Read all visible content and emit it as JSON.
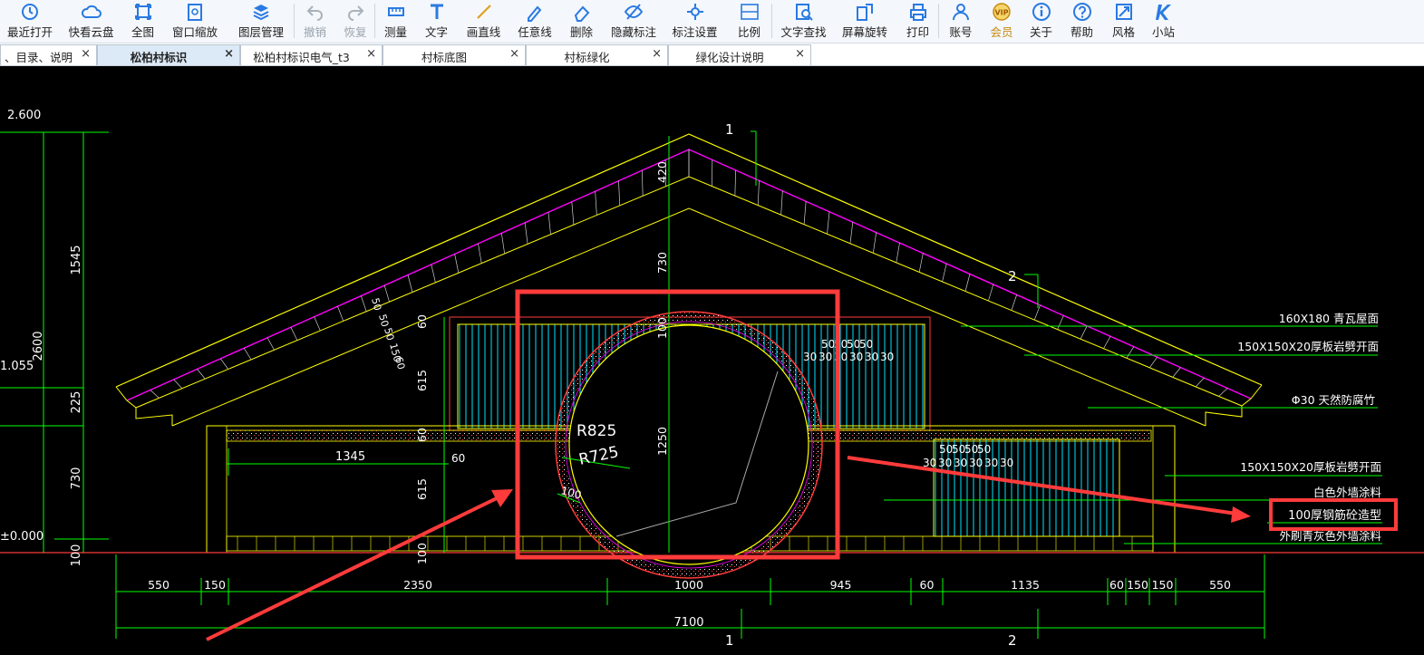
{
  "toolbar": {
    "buttons": [
      {
        "label": "最近打开",
        "icon": "recent-icon"
      },
      {
        "label": "快看云盘",
        "icon": "cloud-icon"
      },
      {
        "label": "全图",
        "icon": "fullview-icon"
      },
      {
        "label": "窗口缩放",
        "icon": "window-zoom-icon"
      },
      {
        "label": "图层管理",
        "icon": "layers-icon"
      },
      {
        "label": "撤销",
        "icon": "undo-icon"
      },
      {
        "label": "恢复",
        "icon": "redo-icon"
      },
      {
        "label": "测量",
        "icon": "measure-icon"
      },
      {
        "label": "文字",
        "icon": "text-icon"
      },
      {
        "label": "画直线",
        "icon": "line-icon"
      },
      {
        "label": "任意线",
        "icon": "freeline-icon"
      },
      {
        "label": "删除",
        "icon": "eraser-icon"
      },
      {
        "label": "隐藏标注",
        "icon": "eye-hide-icon"
      },
      {
        "label": "标注设置",
        "icon": "annotation-settings-icon"
      },
      {
        "label": "比例",
        "icon": "scale-icon"
      },
      {
        "label": "文字查找",
        "icon": "text-search-icon"
      },
      {
        "label": "屏幕旋转",
        "icon": "rotate-icon"
      },
      {
        "label": "打印",
        "icon": "print-icon"
      },
      {
        "label": "账号",
        "icon": "account-icon"
      },
      {
        "label": "会员",
        "icon": "vip-icon"
      },
      {
        "label": "关于",
        "icon": "info-icon"
      },
      {
        "label": "帮助",
        "icon": "help-icon"
      },
      {
        "label": "风格",
        "icon": "style-icon"
      },
      {
        "label": "小站",
        "icon": "site-icon"
      }
    ],
    "vip_badge": "VIP"
  },
  "tabs": [
    {
      "label": "、目录、说明",
      "close": "×"
    },
    {
      "label": "松柏村标识",
      "close": "×"
    },
    {
      "label": "松柏村标识电气_t3",
      "close": "×"
    },
    {
      "label": "村标底图",
      "close": "×"
    },
    {
      "label": "村标绿化",
      "close": "×"
    },
    {
      "label": "绿化设计说明",
      "close": "×"
    }
  ],
  "drawing": {
    "left_levels": [
      "2.600",
      "1.055",
      "±0.000"
    ],
    "left_dims": [
      "1545",
      "2600",
      "225",
      "730",
      "100"
    ],
    "section_marks": [
      "1",
      "2",
      "1",
      "2"
    ],
    "center_dims": [
      "420",
      "730",
      "100",
      "1250",
      "60",
      "615",
      "60",
      "615",
      "100"
    ],
    "small_dims": [
      "50",
      "50",
      "50",
      "150",
      "60"
    ],
    "wall_dims": [
      "1345",
      "60"
    ],
    "radius_labels": [
      "R825",
      "R725",
      "100"
    ],
    "panel_dims_top": [
      "50",
      "50",
      "50",
      "50",
      "30",
      "30",
      "30",
      "30",
      "30",
      "30"
    ],
    "panel_dims_bottom": [
      "50",
      "50",
      "50",
      "50",
      "30",
      "30",
      "30",
      "30",
      "30",
      "30"
    ],
    "bottom_dims": [
      "550",
      "150",
      "2350",
      "1000",
      "945",
      "60",
      "1135",
      "60",
      "150",
      "150",
      "550"
    ],
    "total_dim": "7100",
    "annotations": [
      "160X180 青瓦屋面",
      "150X150X20厚板岩劈开面",
      "Φ30 天然防腐竹",
      "150X150X20厚板岩劈开面",
      "白色外墙涂料",
      "100厚钢筋砼造型",
      "外刷青灰色外墙涂料"
    ]
  },
  "colors": {
    "background": "#000000",
    "dim_line": "#00ff00",
    "outline": "#ffff00",
    "roof_accent": "#ff00ff",
    "infill": "#00ffff",
    "highlight": "#ff3333"
  }
}
